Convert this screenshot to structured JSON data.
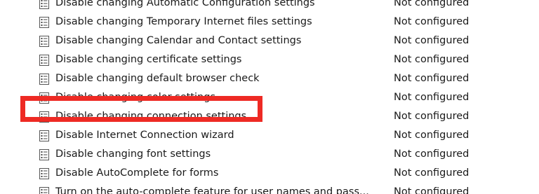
{
  "policy_list": {
    "rows": [
      {
        "name": "Disable changing Automatic Configuration settings",
        "state": "Not configured"
      },
      {
        "name": "Disable changing Temporary Internet files settings",
        "state": "Not configured"
      },
      {
        "name": "Disable changing Calendar and Contact settings",
        "state": "Not configured"
      },
      {
        "name": "Disable changing certificate settings",
        "state": "Not configured"
      },
      {
        "name": "Disable changing default browser check",
        "state": "Not configured"
      },
      {
        "name": "Disable changing color settings",
        "state": "Not configured"
      },
      {
        "name": "Disable changing connection settings",
        "state": "Not configured"
      },
      {
        "name": "Disable Internet Connection wizard",
        "state": "Not configured"
      },
      {
        "name": "Disable changing font settings",
        "state": "Not configured"
      },
      {
        "name": "Disable AutoComplete for forms",
        "state": "Not configured"
      },
      {
        "name": "Turn on the auto-complete feature for user names and pass...",
        "state": "Not configured"
      }
    ],
    "row_icon": "policy-setting-icon"
  },
  "annotation": {
    "highlight_color": "#ee2a24",
    "highlighted_row": "Disable changing connection settings"
  }
}
